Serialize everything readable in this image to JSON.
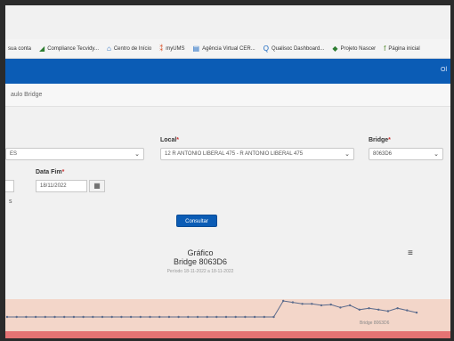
{
  "bookmarks": [
    {
      "icon": "account-icon",
      "glyph": "",
      "label": "sua conta",
      "color": "#333333"
    },
    {
      "icon": "compliance-icon",
      "glyph": "◢",
      "label": "Compliance Tecvidy...",
      "color": "#2e7d32"
    },
    {
      "icon": "home-icon",
      "glyph": "⌂",
      "label": "Centro de Início",
      "color": "#1565c0"
    },
    {
      "icon": "myums-icon",
      "glyph": "⁑",
      "label": "myUMS",
      "color": "#d84315"
    },
    {
      "icon": "agency-icon",
      "glyph": "▤",
      "label": "Agência Virtual CER...",
      "color": "#1565c0"
    },
    {
      "icon": "qualisoc-icon",
      "glyph": "Q",
      "label": "Qualisoc Dashboard...",
      "color": "#1565c0"
    },
    {
      "icon": "project-icon",
      "glyph": "◆",
      "label": "Projeto Nascer",
      "color": "#2e7d32"
    },
    {
      "icon": "page-icon",
      "glyph": "f",
      "label": "Página inicial",
      "color": "#558b2f"
    }
  ],
  "navbar": {
    "right_text": "Ol"
  },
  "breadcrumb": {
    "text": "aulo Bridge"
  },
  "form": {
    "first_select_value": "ES",
    "local_label": "Local",
    "local_value": "12 R ANTONIO LIBERAL 475 - R ANTONIO LIBERAL 475",
    "bridge_label": "Bridge",
    "bridge_value": "8063D6",
    "required_mark": "*",
    "date_fim_label": "Data Fim",
    "date_fim_value": "18/11/2022",
    "calendar_icon": "▦",
    "chevron": "⌄",
    "side_mark": "s"
  },
  "buttons": {
    "consultar": "Consultar"
  },
  "chart": {
    "menu_glyph": "≡"
  },
  "chart_data": {
    "type": "line",
    "title": "Gráfico",
    "subtitle": "Bridge 8063D6",
    "period": "Período 18-11-2022 a 18-11-2022",
    "series": [
      {
        "name": "Bridge 8063D6",
        "color": "#5b6b8c",
        "values": [
          0,
          0,
          0,
          0,
          0,
          0,
          0,
          0,
          0,
          0,
          0,
          0,
          0,
          0,
          0,
          0,
          0,
          0,
          0,
          0,
          0,
          0,
          0,
          0,
          0,
          0,
          0,
          0,
          0,
          22,
          20,
          18,
          18,
          16,
          17,
          13,
          16,
          10,
          12,
          10,
          8,
          12,
          9,
          6
        ]
      }
    ],
    "band_color": "#f3d6c9",
    "bottom_band_color": "#e57373",
    "grid": false,
    "legend_placement": "bottom-right"
  }
}
